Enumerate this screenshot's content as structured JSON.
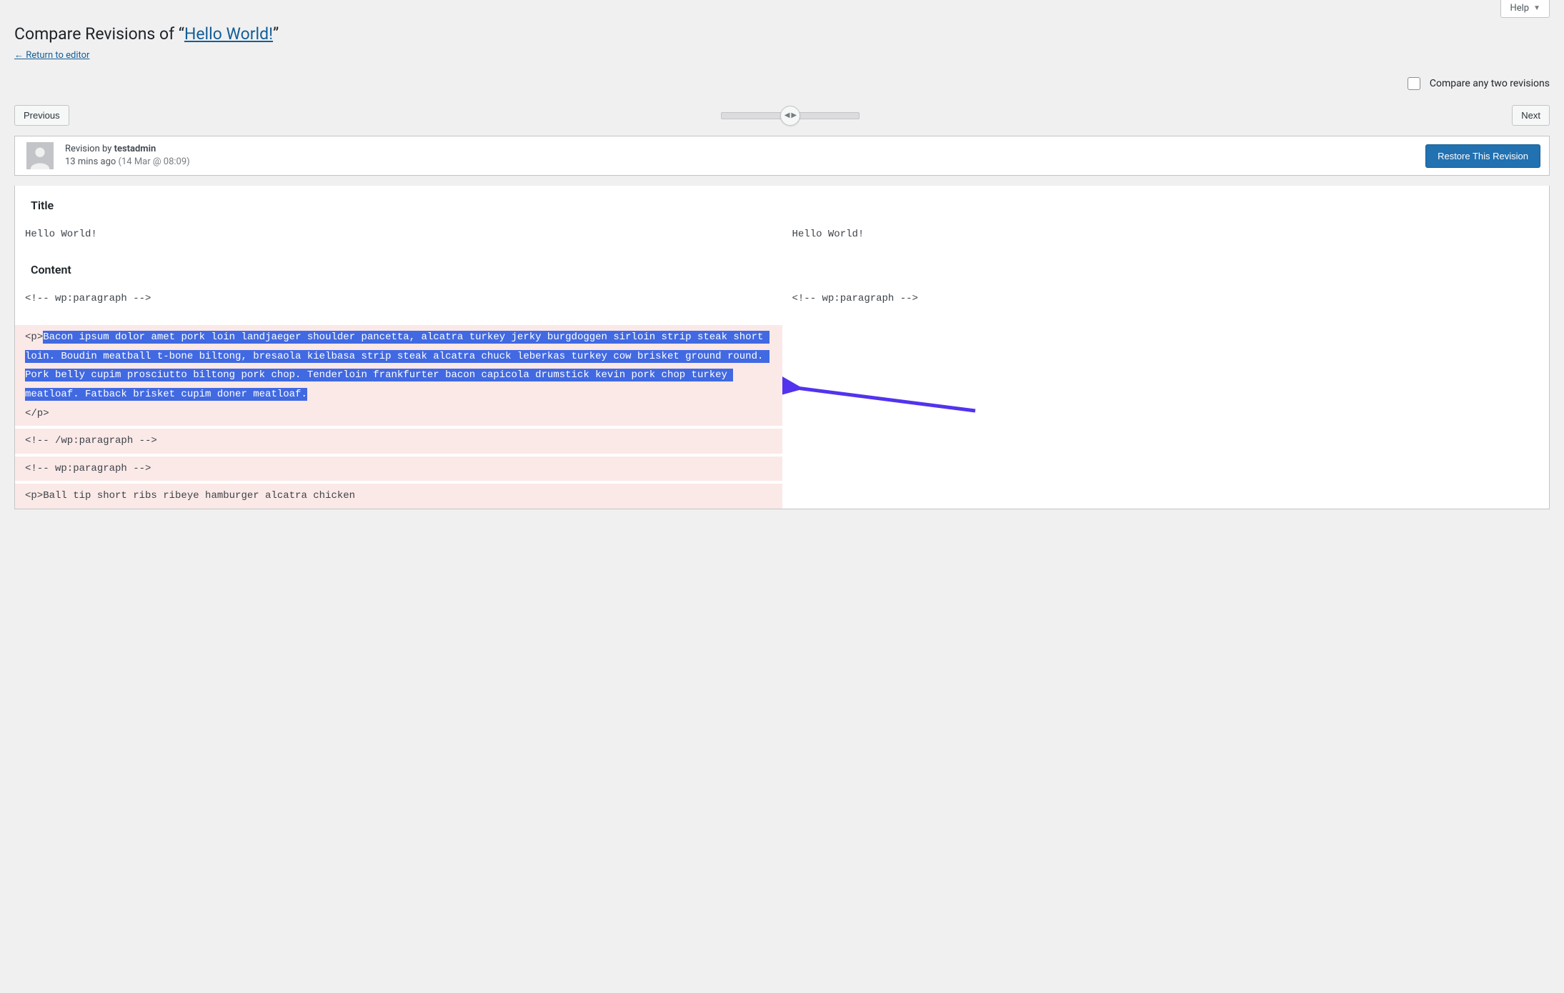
{
  "help_label": "Help",
  "page_title_prefix": "Compare Revisions of “",
  "page_title_link": "Hello World!",
  "page_title_suffix": "”",
  "return_link": "← Return to editor",
  "compare_any_label": "Compare any two revisions",
  "nav": {
    "previous": "Previous",
    "next": "Next"
  },
  "meta": {
    "revision_by_label": "Revision by ",
    "author": "testadmin",
    "time_ago": "13 mins ago",
    "timestamp_paren": "(14 Mar @ 08:09)",
    "restore_label": "Restore This Revision"
  },
  "diff": {
    "sections": {
      "title_heading": "Title",
      "content_heading": "Content"
    },
    "title_left": "Hello World!",
    "title_right": "Hello World!",
    "content_rows": [
      {
        "type": "context",
        "left": "<!-- wp:paragraph -->",
        "right": "<!-- wp:paragraph -->"
      },
      {
        "type": "removed-highlight",
        "left_prefix": "<p>",
        "left_highlight": "Bacon ipsum dolor amet pork loin landjaeger shoulder pancetta, alcatra turkey jerky burgdoggen sirloin strip steak short loin. Boudin meatball t-bone biltong, bresaola kielbasa strip steak alcatra chuck leberkas turkey cow brisket ground round. Pork belly cupim prosciutto biltong pork chop. Tenderloin frankfurter bacon capicola drumstick kevin pork chop turkey meatloaf. Fatback brisket cupim doner meatloaf.",
        "left_suffix": "</p>"
      },
      {
        "type": "removed",
        "left": "<!-- /wp:paragraph -->"
      },
      {
        "type": "removed",
        "left": "<!-- wp:paragraph -->"
      },
      {
        "type": "removed-partial",
        "left_prefix": "<p>",
        "left_rest": "Ball tip short ribs ribeye hamburger alcatra chicken"
      }
    ]
  },
  "annotation": {
    "arrow_color": "#5333ed"
  }
}
